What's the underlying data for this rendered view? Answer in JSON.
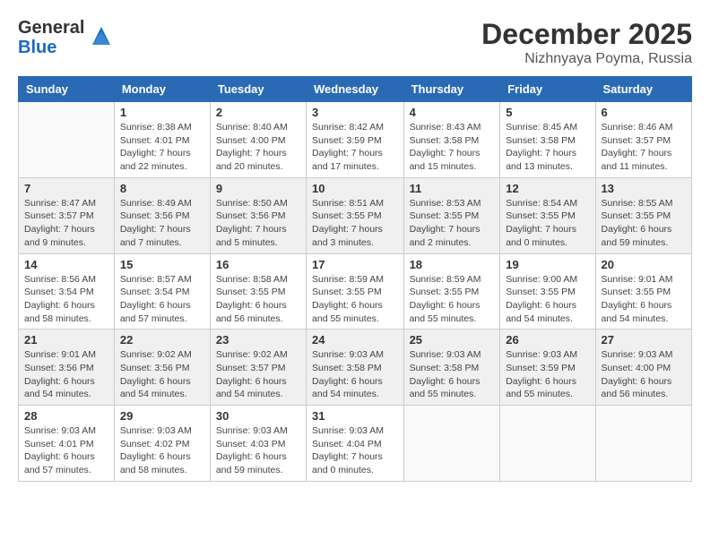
{
  "logo": {
    "general": "General",
    "blue": "Blue"
  },
  "title": "December 2025",
  "subtitle": "Nizhnyaya Poyma, Russia",
  "weekdays": [
    "Sunday",
    "Monday",
    "Tuesday",
    "Wednesday",
    "Thursday",
    "Friday",
    "Saturday"
  ],
  "weeks": [
    [
      {
        "day": "",
        "info": ""
      },
      {
        "day": "1",
        "info": "Sunrise: 8:38 AM\nSunset: 4:01 PM\nDaylight: 7 hours\nand 22 minutes."
      },
      {
        "day": "2",
        "info": "Sunrise: 8:40 AM\nSunset: 4:00 PM\nDaylight: 7 hours\nand 20 minutes."
      },
      {
        "day": "3",
        "info": "Sunrise: 8:42 AM\nSunset: 3:59 PM\nDaylight: 7 hours\nand 17 minutes."
      },
      {
        "day": "4",
        "info": "Sunrise: 8:43 AM\nSunset: 3:58 PM\nDaylight: 7 hours\nand 15 minutes."
      },
      {
        "day": "5",
        "info": "Sunrise: 8:45 AM\nSunset: 3:58 PM\nDaylight: 7 hours\nand 13 minutes."
      },
      {
        "day": "6",
        "info": "Sunrise: 8:46 AM\nSunset: 3:57 PM\nDaylight: 7 hours\nand 11 minutes."
      }
    ],
    [
      {
        "day": "7",
        "info": "Sunrise: 8:47 AM\nSunset: 3:57 PM\nDaylight: 7 hours\nand 9 minutes."
      },
      {
        "day": "8",
        "info": "Sunrise: 8:49 AM\nSunset: 3:56 PM\nDaylight: 7 hours\nand 7 minutes."
      },
      {
        "day": "9",
        "info": "Sunrise: 8:50 AM\nSunset: 3:56 PM\nDaylight: 7 hours\nand 5 minutes."
      },
      {
        "day": "10",
        "info": "Sunrise: 8:51 AM\nSunset: 3:55 PM\nDaylight: 7 hours\nand 3 minutes."
      },
      {
        "day": "11",
        "info": "Sunrise: 8:53 AM\nSunset: 3:55 PM\nDaylight: 7 hours\nand 2 minutes."
      },
      {
        "day": "12",
        "info": "Sunrise: 8:54 AM\nSunset: 3:55 PM\nDaylight: 7 hours\nand 0 minutes."
      },
      {
        "day": "13",
        "info": "Sunrise: 8:55 AM\nSunset: 3:55 PM\nDaylight: 6 hours\nand 59 minutes."
      }
    ],
    [
      {
        "day": "14",
        "info": "Sunrise: 8:56 AM\nSunset: 3:54 PM\nDaylight: 6 hours\nand 58 minutes."
      },
      {
        "day": "15",
        "info": "Sunrise: 8:57 AM\nSunset: 3:54 PM\nDaylight: 6 hours\nand 57 minutes."
      },
      {
        "day": "16",
        "info": "Sunrise: 8:58 AM\nSunset: 3:55 PM\nDaylight: 6 hours\nand 56 minutes."
      },
      {
        "day": "17",
        "info": "Sunrise: 8:59 AM\nSunset: 3:55 PM\nDaylight: 6 hours\nand 55 minutes."
      },
      {
        "day": "18",
        "info": "Sunrise: 8:59 AM\nSunset: 3:55 PM\nDaylight: 6 hours\nand 55 minutes."
      },
      {
        "day": "19",
        "info": "Sunrise: 9:00 AM\nSunset: 3:55 PM\nDaylight: 6 hours\nand 54 minutes."
      },
      {
        "day": "20",
        "info": "Sunrise: 9:01 AM\nSunset: 3:55 PM\nDaylight: 6 hours\nand 54 minutes."
      }
    ],
    [
      {
        "day": "21",
        "info": "Sunrise: 9:01 AM\nSunset: 3:56 PM\nDaylight: 6 hours\nand 54 minutes."
      },
      {
        "day": "22",
        "info": "Sunrise: 9:02 AM\nSunset: 3:56 PM\nDaylight: 6 hours\nand 54 minutes."
      },
      {
        "day": "23",
        "info": "Sunrise: 9:02 AM\nSunset: 3:57 PM\nDaylight: 6 hours\nand 54 minutes."
      },
      {
        "day": "24",
        "info": "Sunrise: 9:03 AM\nSunset: 3:58 PM\nDaylight: 6 hours\nand 54 minutes."
      },
      {
        "day": "25",
        "info": "Sunrise: 9:03 AM\nSunset: 3:58 PM\nDaylight: 6 hours\nand 55 minutes."
      },
      {
        "day": "26",
        "info": "Sunrise: 9:03 AM\nSunset: 3:59 PM\nDaylight: 6 hours\nand 55 minutes."
      },
      {
        "day": "27",
        "info": "Sunrise: 9:03 AM\nSunset: 4:00 PM\nDaylight: 6 hours\nand 56 minutes."
      }
    ],
    [
      {
        "day": "28",
        "info": "Sunrise: 9:03 AM\nSunset: 4:01 PM\nDaylight: 6 hours\nand 57 minutes."
      },
      {
        "day": "29",
        "info": "Sunrise: 9:03 AM\nSunset: 4:02 PM\nDaylight: 6 hours\nand 58 minutes."
      },
      {
        "day": "30",
        "info": "Sunrise: 9:03 AM\nSunset: 4:03 PM\nDaylight: 6 hours\nand 59 minutes."
      },
      {
        "day": "31",
        "info": "Sunrise: 9:03 AM\nSunset: 4:04 PM\nDaylight: 7 hours\nand 0 minutes."
      },
      {
        "day": "",
        "info": ""
      },
      {
        "day": "",
        "info": ""
      },
      {
        "day": "",
        "info": ""
      }
    ]
  ]
}
